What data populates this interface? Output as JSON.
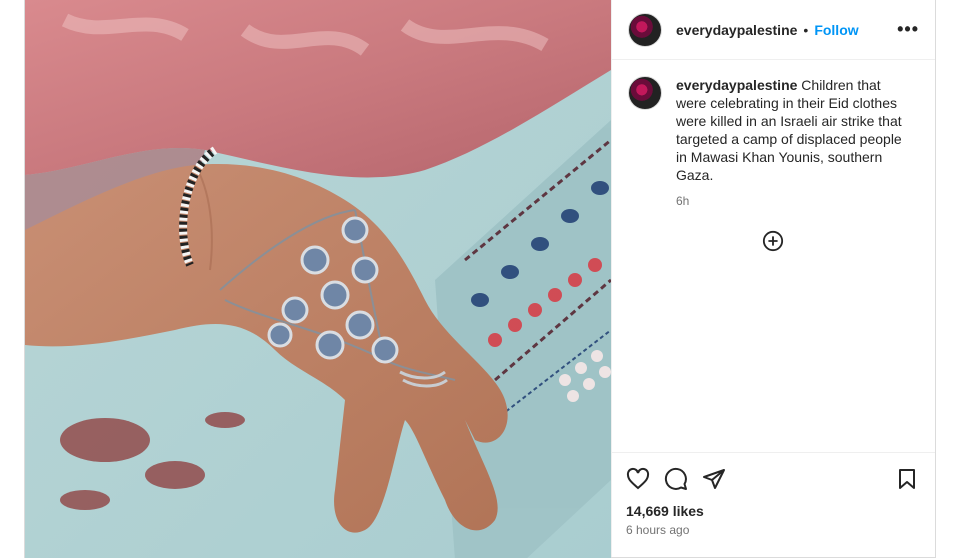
{
  "post": {
    "username": "everydaypalestine",
    "separator": "•",
    "follow_label": "Follow",
    "more_label": "•••",
    "caption": "Children that were celebrating in their Eid clothes were killed in an Israeli air strike that targeted a camp of displaced people in Mawasi Khan Younis, southern Gaza.",
    "caption_age": "6h",
    "likes": "14,669 likes",
    "posted_ago": "6 hours ago"
  },
  "icons": {
    "like": "heart-icon",
    "comment": "comment-icon",
    "share": "paper-plane-icon",
    "save": "bookmark-icon",
    "more": "more-options-icon",
    "load_comments": "plus-circle-icon"
  },
  "colors": {
    "follow": "#0095f6",
    "secondary_text": "#737373",
    "divider": "#efefef"
  }
}
